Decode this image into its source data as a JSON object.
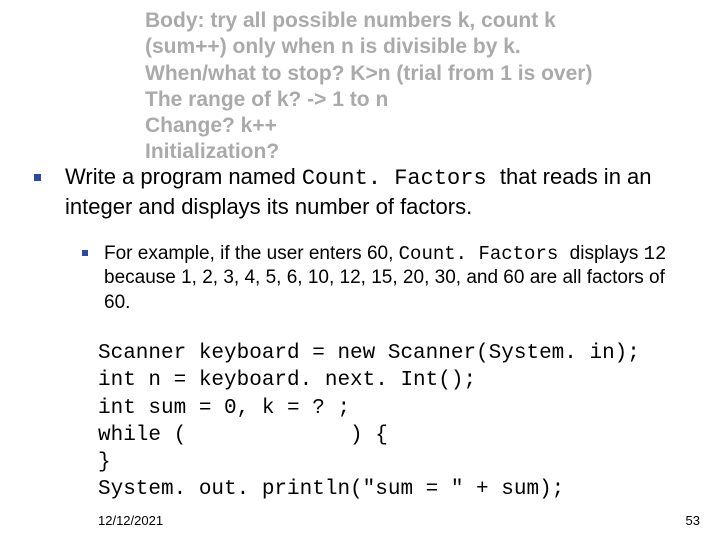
{
  "notes": {
    "l1": "Body: try all possible numbers k, count k",
    "l2": "(sum++) only when n is divisible by k.",
    "l3": "When/what to stop?  K>n (trial from 1 is over)",
    "l4": "The range of k? -> 1 to n",
    "l5": "Change?  k++",
    "l6": "Initialization?"
  },
  "bullet1": {
    "pre": "Write a program named ",
    "code": "Count. Factors ",
    "post": " that reads in an integer and displays its number of factors."
  },
  "bullet2": {
    "pre": "For example, if the user enters 60, ",
    "code": "Count. Factors ",
    "mid": " displays ",
    "code2": "12",
    "post": " because 1, 2, 3, 4, 5, 6, 10, 12, 15, 20, 30, and 60 are all factors of 60."
  },
  "code": {
    "l1": "Scanner keyboard = new Scanner(System. in);",
    "l2": "int n = keyboard. next. Int();",
    "l3": "int sum = 0, k = ? ;",
    "l4": "while (             ) {",
    "l5": "}",
    "l6": "System. out. println(\"sum = \" + sum);"
  },
  "footer": {
    "date": "12/12/2021",
    "page": "53"
  }
}
